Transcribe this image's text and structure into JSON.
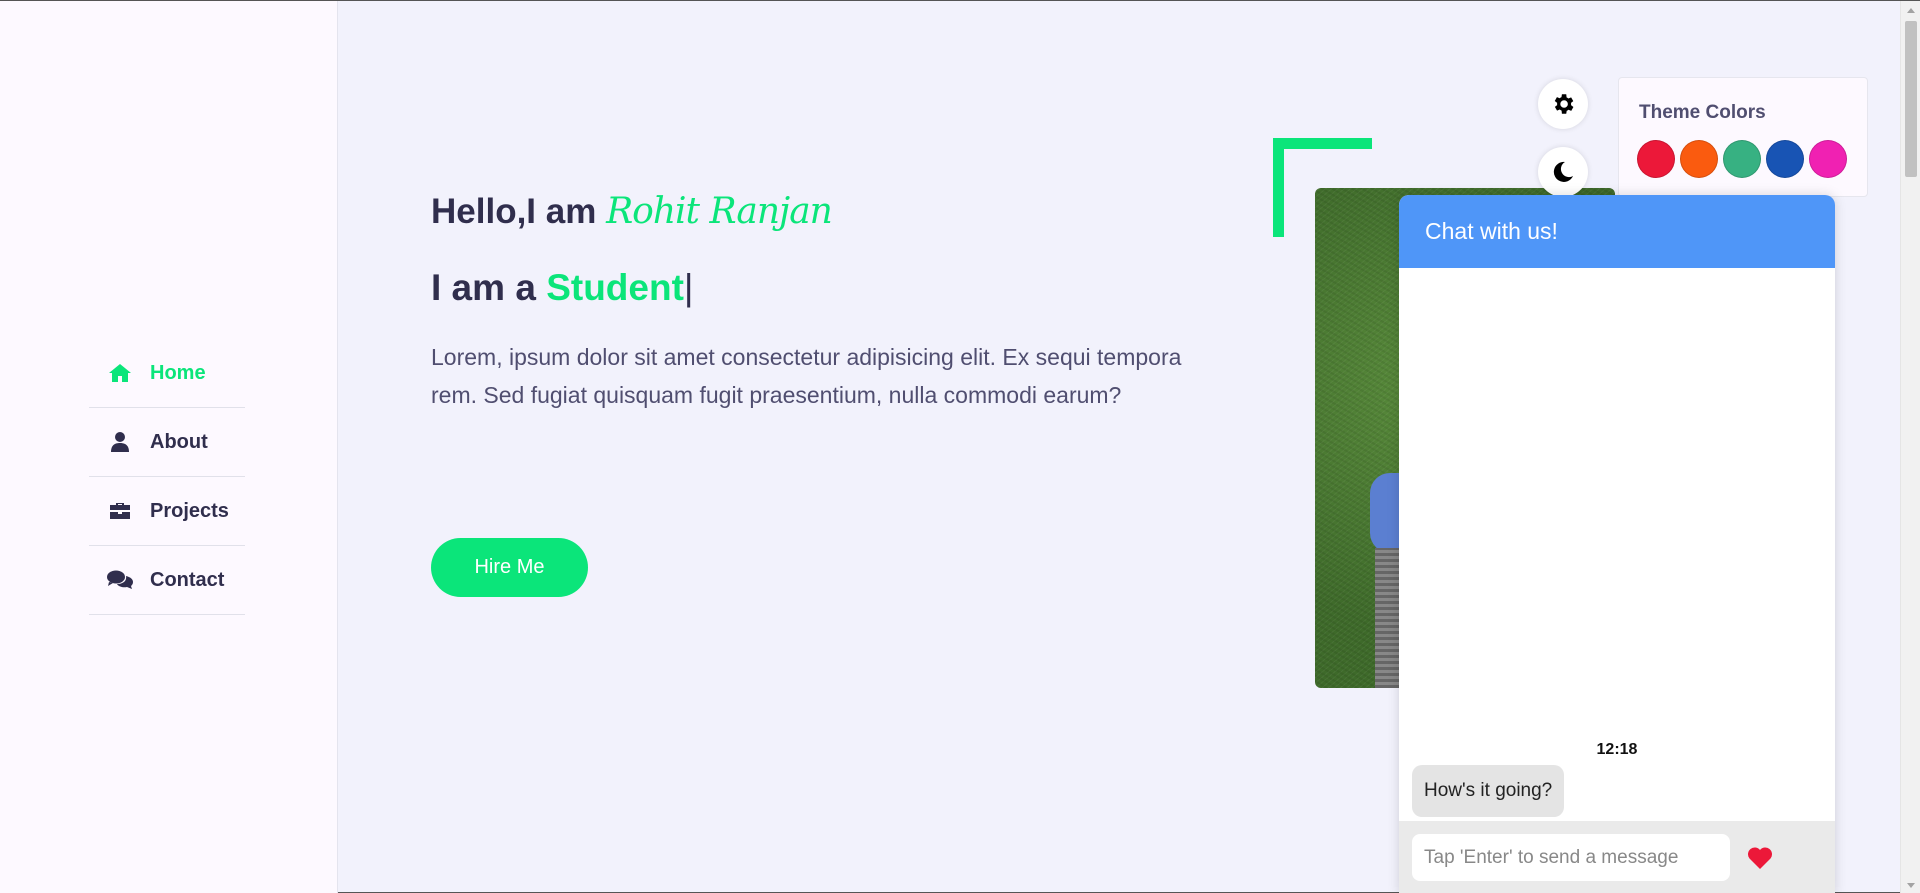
{
  "nav": {
    "items": [
      {
        "label": "Home",
        "icon": "home-icon",
        "active": true
      },
      {
        "label": "About",
        "icon": "user-icon",
        "active": false
      },
      {
        "label": "Projects",
        "icon": "briefcase-icon",
        "active": false
      },
      {
        "label": "Contact",
        "icon": "comments-icon",
        "active": false
      }
    ]
  },
  "hero": {
    "greeting": "Hello,I am ",
    "name": "Rohit Ranjan",
    "role_prefix": "I am a ",
    "role": "Student",
    "caret": "|",
    "description": "Lorem, ipsum dolor sit amet consectetur adipisicing elit. Ex sequi tempora rem. Sed fugiat quisquam fugit praesentium, nulla commodi earum?",
    "hire_button": "Hire Me"
  },
  "theme": {
    "title": "Theme Colors",
    "swatches": [
      "#ec1839",
      "#fa5b0f",
      "#37b182",
      "#1854b4",
      "#f021b2"
    ],
    "accent": "#0be57a"
  },
  "chat": {
    "title": "Chat with us!",
    "time": "12:18",
    "message": "How's it going?",
    "input_placeholder": "Tap 'Enter' to send a message",
    "header_color": "#4f96f8",
    "heart_color": "#ec1839"
  }
}
